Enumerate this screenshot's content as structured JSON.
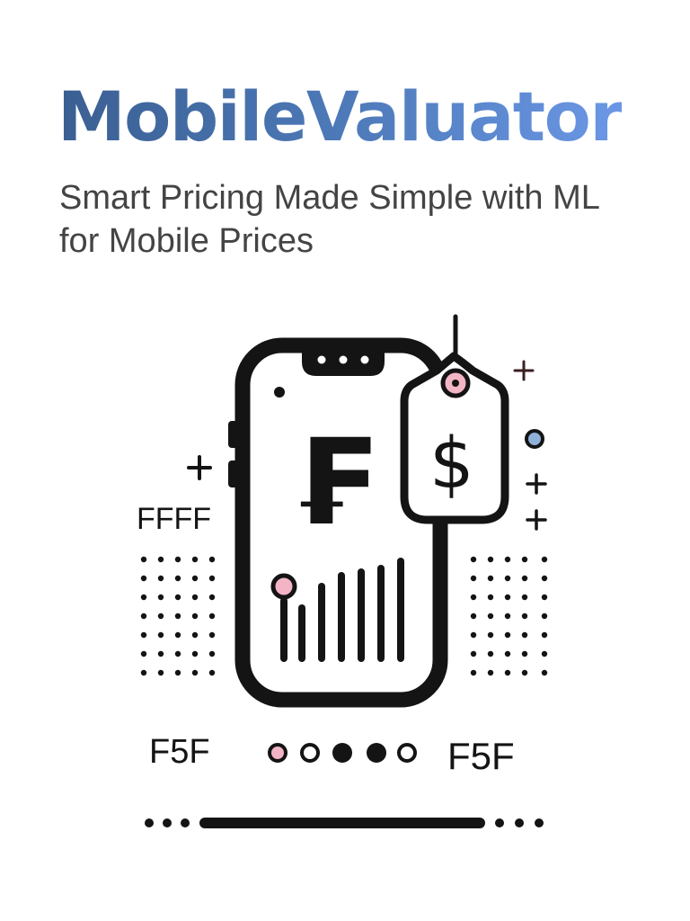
{
  "header": {
    "title": "MobileValuator",
    "tagline": "Smart Pricing Made Simple with ML for Mobile Prices"
  },
  "illustration": {
    "currency_symbol": "₣",
    "price_tag_symbol": "$",
    "side_label_left": "FFFF",
    "bottom_label_left": "F5F",
    "bottom_label_right": "F5F",
    "icons": [
      "smartphone-icon",
      "price-tag-icon",
      "bar-chart-icon",
      "franc-icon",
      "dollar-icon"
    ]
  },
  "colors": {
    "title_gradient_start": "#3a5f92",
    "title_gradient_end": "#6b97e6",
    "tagline": "#444444",
    "ink": "#141414",
    "accent_pink": "#f3b4c6",
    "accent_blue": "#8fb0d8"
  }
}
